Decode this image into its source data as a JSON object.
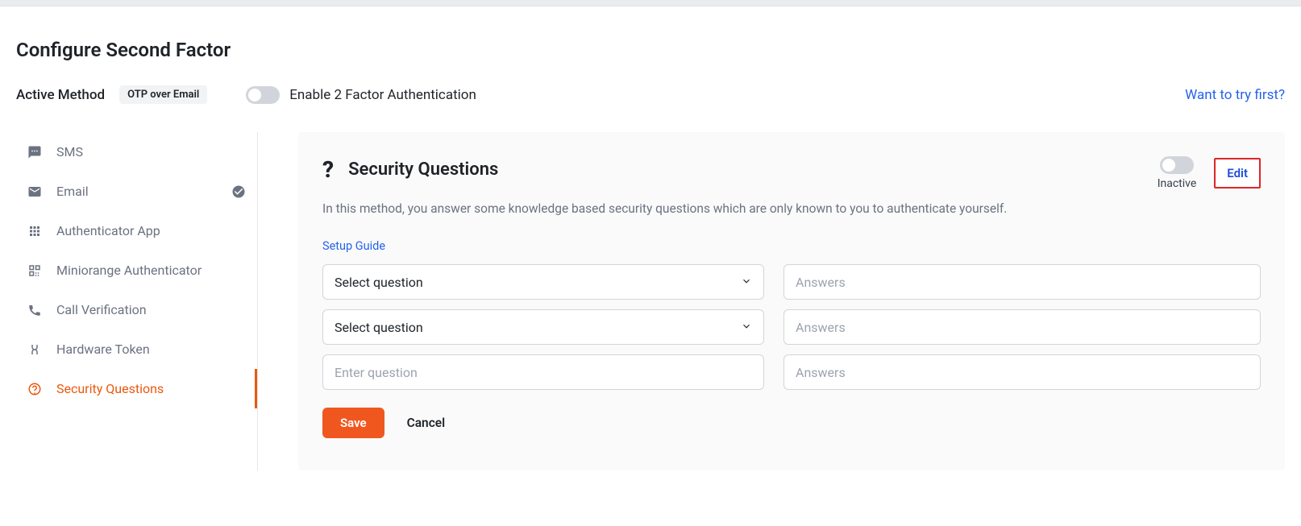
{
  "header": {
    "title": "Configure Second Factor",
    "active_method_label": "Active Method",
    "active_method_badge": "OTP over Email",
    "enable_2fa_label": "Enable 2 Factor Authentication",
    "want_to_try": "Want to try first?"
  },
  "sidebar": {
    "items": [
      {
        "label": "SMS",
        "icon": "sms-icon",
        "active": false,
        "configured": false
      },
      {
        "label": "Email",
        "icon": "email-icon",
        "active": false,
        "configured": true
      },
      {
        "label": "Authenticator App",
        "icon": "grid-apps-icon",
        "active": false,
        "configured": false
      },
      {
        "label": "Miniorange Authenticator",
        "icon": "qr-icon",
        "active": false,
        "configured": false
      },
      {
        "label": "Call Verification",
        "icon": "phone-icon",
        "active": false,
        "configured": false
      },
      {
        "label": "Hardware Token",
        "icon": "token-icon",
        "active": false,
        "configured": false
      },
      {
        "label": "Security Questions",
        "icon": "question-icon",
        "active": true,
        "configured": false
      }
    ]
  },
  "panel": {
    "title": "Security Questions",
    "description": "In this method, you answer some knowledge based security questions which are only known to you to authenticate yourself.",
    "inactive_label": "Inactive",
    "edit_label": "Edit",
    "setup_guide_label": "Setup Guide",
    "question_select_placeholder": "Select question",
    "enter_question_placeholder": "Enter question",
    "answer_placeholder": "Answers",
    "save_label": "Save",
    "cancel_label": "Cancel"
  }
}
